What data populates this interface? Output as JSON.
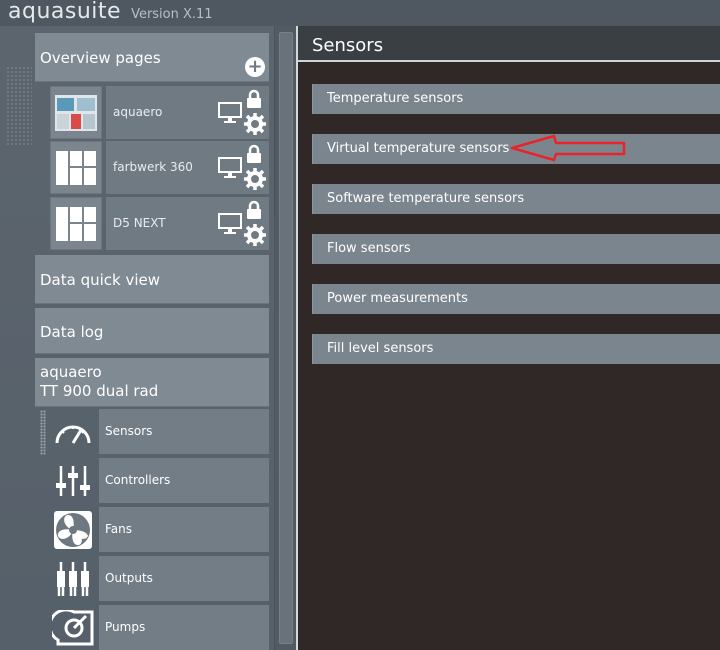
{
  "app": {
    "name": "aquasuite",
    "version": "Version X.11"
  },
  "sidebar": {
    "overview_title": "Overview pages",
    "devices": [
      {
        "label": "aquaero"
      },
      {
        "label": "farbwerk 360"
      },
      {
        "label": "D5 NEXT"
      }
    ],
    "data_quick_view": "Data quick view",
    "data_log": "Data log",
    "device_group": {
      "line1": "aquaero",
      "line2": "TT 900 dual rad"
    },
    "sub_items": [
      {
        "label": "Sensors",
        "icon": "gauge-icon"
      },
      {
        "label": "Controllers",
        "icon": "sliders-icon"
      },
      {
        "label": "Fans",
        "icon": "fan-icon"
      },
      {
        "label": "Outputs",
        "icon": "outputs-icon"
      },
      {
        "label": "Pumps",
        "icon": "pump-icon"
      }
    ]
  },
  "main": {
    "title": "Sensors",
    "categories": [
      {
        "label": "Temperature sensors"
      },
      {
        "label": "Virtual temperature sensors"
      },
      {
        "label": "Software temperature sensors"
      },
      {
        "label": "Flow sensors"
      },
      {
        "label": "Power measurements"
      },
      {
        "label": "Fill level sensors"
      }
    ],
    "annotation_color": "#e8242a"
  }
}
